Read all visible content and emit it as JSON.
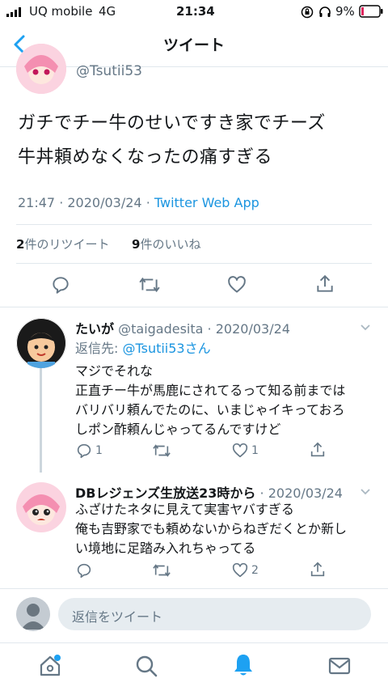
{
  "status_bar": {
    "carrier": "UQ mobile",
    "network": "4G",
    "time": "21:34",
    "battery": "9%"
  },
  "nav": {
    "title": "ツイート",
    "back_icon": "chevron-left-icon"
  },
  "tweet": {
    "handle": "@Tsutii53",
    "text_line1": "ガチでチー牛のせいですき家でチーズ",
    "text_line2": "牛丼頼めなくなったの痛すぎる",
    "time": "21:47",
    "date": "2020/03/24",
    "source": "Twitter Web App",
    "retweet_count": "2",
    "retweet_label": "件のリツイート",
    "like_count": "9",
    "like_label": "件のいいね"
  },
  "replies": [
    {
      "name": "たいが",
      "handle": "@taigadesita",
      "date": "2020/03/24",
      "reply_to_label": "返信先: ",
      "reply_to": "@Tsutii53さん",
      "lines": [
        "マジでそれな",
        "正直チー牛が馬鹿にされてるって知る前までは",
        "バリバリ頼んでたのに、いまじゃイキっておろ",
        "しポン酢頼んじゃってるんですけど"
      ],
      "reply_count": "1",
      "like_count": "1"
    },
    {
      "name": "DBレジェンズ生放送23時から",
      "handle": "",
      "date": "2020/03/24",
      "lines": [
        "ふざけたネタに見えて実害ヤバすぎる",
        "俺も吉野家でも頼めないからねぎだくとか新し",
        "い境地に足踏み入れちゃってる"
      ],
      "like_count": "2"
    }
  ],
  "compose": {
    "placeholder": "返信をツイート"
  },
  "colors": {
    "accent": "#1da1f2",
    "link": "#1b95e0",
    "muted": "#657786",
    "divider": "#e1e8ed"
  }
}
